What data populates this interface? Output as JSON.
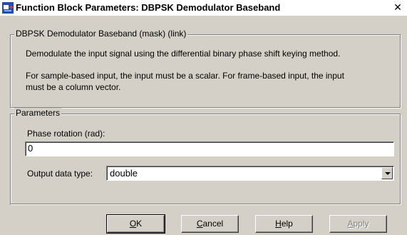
{
  "window": {
    "title": "Function Block Parameters: DBPSK Demodulator Baseband",
    "close_glyph": "✕"
  },
  "mask_group": {
    "legend": "DBPSK Demodulator Baseband (mask) (link)",
    "description_line1": "Demodulate the input signal using the differential binary phase shift keying method.",
    "description_line2": "For sample-based input, the input must be a scalar. For frame-based input, the input",
    "description_line3": "must be a column vector."
  },
  "parameters_group": {
    "legend": "Parameters",
    "phase_label": "Phase rotation (rad):",
    "phase_value": "0",
    "output_label": "Output data type:",
    "output_value": "double"
  },
  "buttons": {
    "ok_mnemonic": "O",
    "ok_rest": "K",
    "cancel_mnemonic": "C",
    "cancel_rest": "ancel",
    "help_mnemonic": "H",
    "help_rest": "elp",
    "apply_mnemonic": "A",
    "apply_rest": "pply"
  },
  "icons": {
    "title_icon": "simulink-block-icon",
    "close_icon": "close-icon",
    "dropdown_icon": "chevron-down-icon"
  }
}
